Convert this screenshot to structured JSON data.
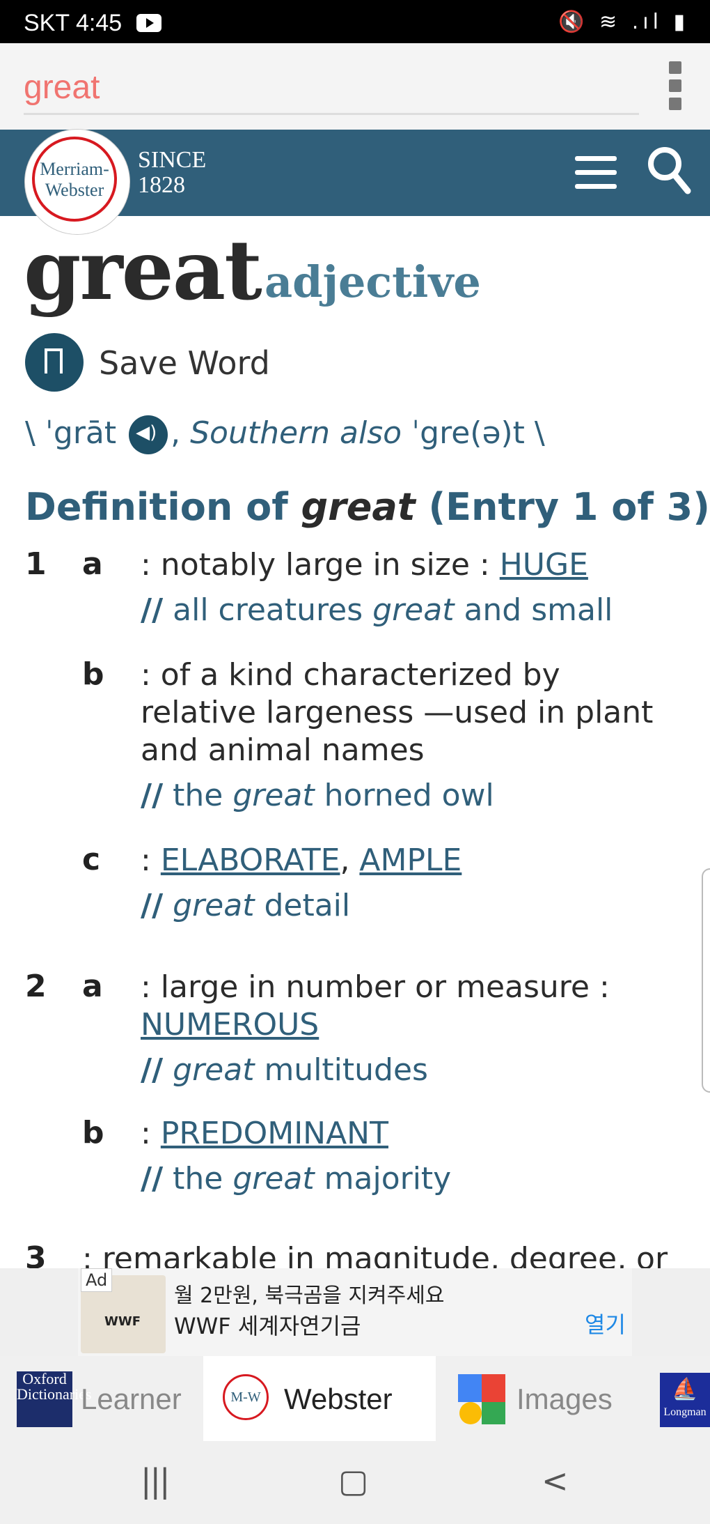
{
  "status": {
    "time": "SKT 4:45",
    "icons": "🔇 ≋ .ıl ▮"
  },
  "search": {
    "query": "great"
  },
  "header": {
    "logo_line1": "Merriam-",
    "logo_line2": "Webster",
    "since": "SINCE",
    "year": "1828"
  },
  "entry": {
    "word": "great",
    "part_of_speech": "adjective",
    "save_label": "Save Word",
    "pron_open": "\\ ˈgrāt",
    "pron_sep": ", ",
    "pron_also": "Southern also",
    "pron_alt": " ˈgre(ə)t \\",
    "def_prefix": "Definition of ",
    "def_word": "great",
    "def_suffix": " (Entry 1 of 3)"
  },
  "senses": {
    "s1": "1",
    "s1a_letter": "a",
    "s1a_text": ": notably large in size : ",
    "s1a_link": "HUGE",
    "s1a_ex_pre": "all creatures ",
    "s1a_ex_word": "great",
    "s1a_ex_post": " and small",
    "s1b_letter": "b",
    "s1b_text": ": of a kind characterized by relative largeness —used in plant and animal names",
    "s1b_ex_pre": "the ",
    "s1b_ex_word": "great",
    "s1b_ex_post": " horned owl",
    "s1c_letter": "c",
    "s1c_colon": ": ",
    "s1c_link1": "ELABORATE",
    "s1c_comma": ", ",
    "s1c_link2": "AMPLE",
    "s1c_ex_word": "great",
    "s1c_ex_post": " detail",
    "s2": "2",
    "s2a_letter": "a",
    "s2a_text": ": large in number or measure : ",
    "s2a_link": "NUMEROUS",
    "s2a_ex_word": "great",
    "s2a_ex_post": " multitudes",
    "s2b_letter": "b",
    "s2b_colon": ": ",
    "s2b_link": "PREDOMINANT",
    "s2b_ex_pre": "the ",
    "s2b_ex_word": "great",
    "s2b_ex_post": " majority",
    "s3": "3",
    "s3_text": ": remarkable in magnitude, degree, or",
    "ex_mark": "//"
  },
  "ad": {
    "tag": "Ad",
    "title": "월 2만원, 북극곰을 지켜주세요",
    "sub": "WWF 세계자연기금",
    "open": "열기"
  },
  "tabs": {
    "learner": "Learner",
    "webster": "Webster",
    "images": "Images",
    "oxford": "Oxford Dictionaries",
    "mw": "M-W",
    "longman": "Longman"
  },
  "nav": {
    "recent": "|||",
    "home": "▢",
    "back": "<"
  }
}
